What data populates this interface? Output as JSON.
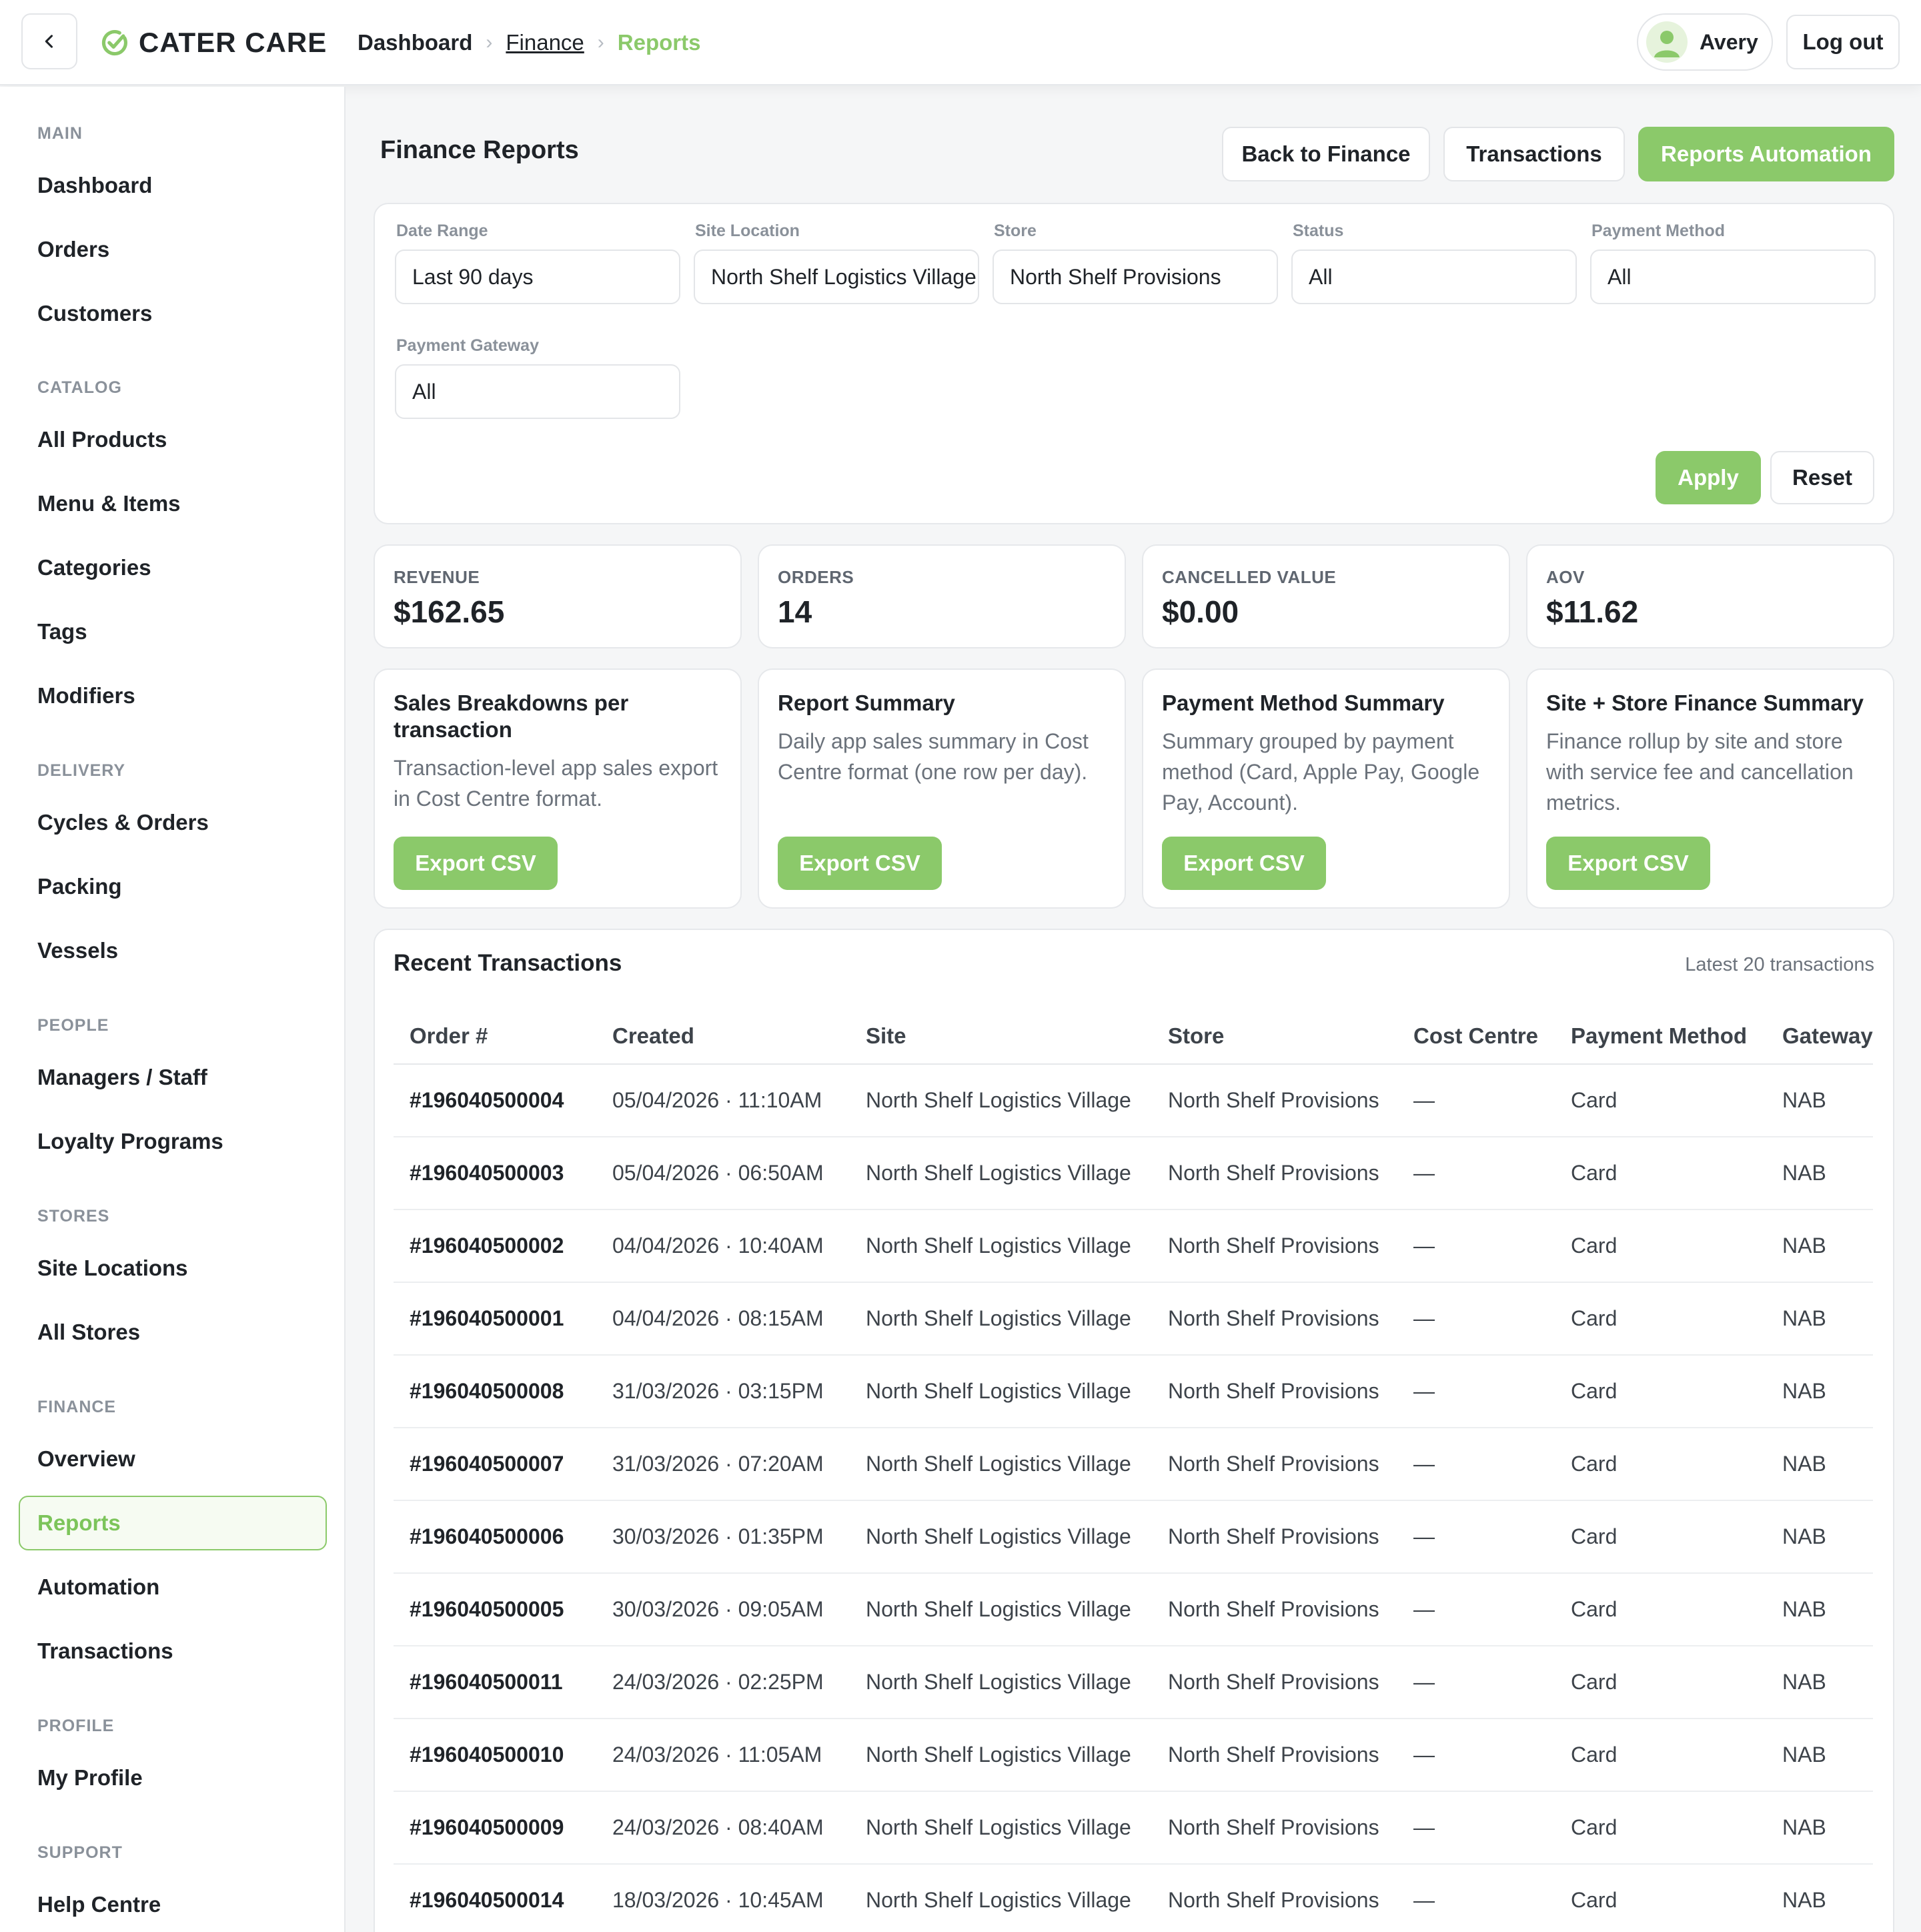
{
  "header": {
    "logo_text": "CATER CARE",
    "breadcrumbs": [
      "Dashboard",
      "Finance",
      "Reports"
    ],
    "user_name": "Avery",
    "logout_label": "Log out"
  },
  "sidebar": {
    "sections": [
      {
        "title": "MAIN",
        "items": [
          "Dashboard",
          "Orders",
          "Customers"
        ]
      },
      {
        "title": "CATALOG",
        "items": [
          "All Products",
          "Menu & Items",
          "Categories",
          "Tags",
          "Modifiers"
        ]
      },
      {
        "title": "DELIVERY",
        "items": [
          "Cycles & Orders",
          "Packing",
          "Vessels"
        ]
      },
      {
        "title": "PEOPLE",
        "items": [
          "Managers / Staff",
          "Loyalty Programs"
        ]
      },
      {
        "title": "STORES",
        "items": [
          "Site Locations",
          "All Stores"
        ]
      },
      {
        "title": "FINANCE",
        "items": [
          "Overview",
          "Reports",
          "Automation",
          "Transactions"
        ]
      },
      {
        "title": "PROFILE",
        "items": [
          "My Profile"
        ]
      },
      {
        "title": "SUPPORT",
        "items": [
          "Help Centre"
        ]
      }
    ],
    "active_item": "Reports"
  },
  "main": {
    "title": "Finance Reports",
    "buttons": {
      "back": "Back to Finance",
      "transactions": "Transactions",
      "automation": "Reports Automation"
    }
  },
  "filters": {
    "date_range": {
      "label": "Date Range",
      "value": "Last 90 days"
    },
    "site_location": {
      "label": "Site Location",
      "value": "North Shelf Logistics Village"
    },
    "store": {
      "label": "Store",
      "value": "North Shelf Provisions"
    },
    "status": {
      "label": "Status",
      "value": "All"
    },
    "payment_method": {
      "label": "Payment Method",
      "value": "All"
    },
    "payment_gateway": {
      "label": "Payment Gateway",
      "value": "All"
    },
    "apply_label": "Apply",
    "reset_label": "Reset"
  },
  "stats": [
    {
      "label": "REVENUE",
      "value": "$162.65"
    },
    {
      "label": "ORDERS",
      "value": "14"
    },
    {
      "label": "CANCELLED VALUE",
      "value": "$0.00"
    },
    {
      "label": "AOV",
      "value": "$11.62"
    }
  ],
  "reports": [
    {
      "title": "Sales Breakdowns per transaction",
      "description": "Transaction-level app sales export in Cost Centre format.",
      "button": "Export CSV"
    },
    {
      "title": "Report Summary",
      "description": "Daily app sales summary in Cost Centre format (one row per day).",
      "button": "Export CSV"
    },
    {
      "title": "Payment Method Summary",
      "description": "Summary grouped by payment method (Card, Apple Pay, Google Pay, Account).",
      "button": "Export CSV"
    },
    {
      "title": "Site + Store Finance Summary",
      "description": "Finance rollup by site and store with service fee and cancellation metrics.",
      "button": "Export CSV"
    }
  ],
  "transactions": {
    "title": "Recent Transactions",
    "note": "Latest 20 transactions",
    "columns": [
      "Order #",
      "Created",
      "Site",
      "Store",
      "Cost Centre",
      "Payment Method",
      "Gateway"
    ],
    "rows": [
      [
        "#196040500004",
        "05/04/2026 · 11:10AM",
        "North Shelf Logistics Village",
        "North Shelf Provisions",
        "—",
        "Card",
        "NAB"
      ],
      [
        "#196040500003",
        "05/04/2026 · 06:50AM",
        "North Shelf Logistics Village",
        "North Shelf Provisions",
        "—",
        "Card",
        "NAB"
      ],
      [
        "#196040500002",
        "04/04/2026 · 10:40AM",
        "North Shelf Logistics Village",
        "North Shelf Provisions",
        "—",
        "Card",
        "NAB"
      ],
      [
        "#196040500001",
        "04/04/2026 · 08:15AM",
        "North Shelf Logistics Village",
        "North Shelf Provisions",
        "—",
        "Card",
        "NAB"
      ],
      [
        "#196040500008",
        "31/03/2026 · 03:15PM",
        "North Shelf Logistics Village",
        "North Shelf Provisions",
        "—",
        "Card",
        "NAB"
      ],
      [
        "#196040500007",
        "31/03/2026 · 07:20AM",
        "North Shelf Logistics Village",
        "North Shelf Provisions",
        "—",
        "Card",
        "NAB"
      ],
      [
        "#196040500006",
        "30/03/2026 · 01:35PM",
        "North Shelf Logistics Village",
        "North Shelf Provisions",
        "—",
        "Card",
        "NAB"
      ],
      [
        "#196040500005",
        "30/03/2026 · 09:05AM",
        "North Shelf Logistics Village",
        "North Shelf Provisions",
        "—",
        "Card",
        "NAB"
      ],
      [
        "#196040500011",
        "24/03/2026 · 02:25PM",
        "North Shelf Logistics Village",
        "North Shelf Provisions",
        "—",
        "Card",
        "NAB"
      ],
      [
        "#196040500010",
        "24/03/2026 · 11:05AM",
        "North Shelf Logistics Village",
        "North Shelf Provisions",
        "—",
        "Card",
        "NAB"
      ],
      [
        "#196040500009",
        "24/03/2026 · 08:40AM",
        "North Shelf Logistics Village",
        "North Shelf Provisions",
        "—",
        "Card",
        "NAB"
      ],
      [
        "#196040500014",
        "18/03/2026 · 10:45AM",
        "North Shelf Logistics Village",
        "North Shelf Provisions",
        "—",
        "Card",
        "NAB"
      ]
    ]
  },
  "colors": {
    "accent": "#8bc96a",
    "border": "#e6e8eb",
    "muted": "#8a919a"
  },
  "icons": {
    "back": "chevron-left-icon",
    "logo": "check-circle-icon",
    "breadcrumb_separator": "chevron-right-icon",
    "avatar": "user-avatar-icon"
  }
}
